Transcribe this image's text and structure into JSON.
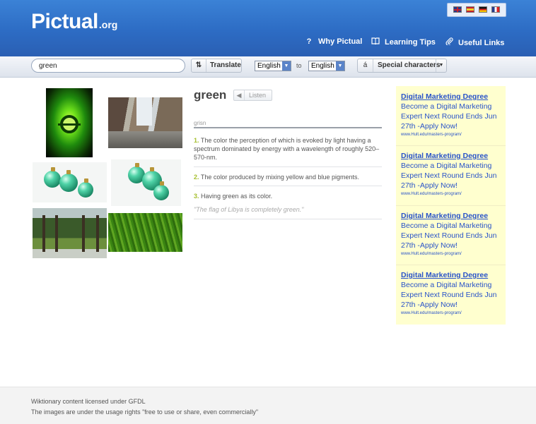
{
  "header": {
    "logo_main": "Pictual",
    "logo_tld": ".org",
    "languages": [
      "en",
      "es",
      "de",
      "fr"
    ],
    "nav": [
      {
        "label": "Why Pictual",
        "icon": "question-icon"
      },
      {
        "label": "Learning Tips",
        "icon": "book-icon"
      },
      {
        "label": "Useful Links",
        "icon": "paperclip-icon"
      }
    ]
  },
  "toolbar": {
    "search_value": "green",
    "translate_label": "Translate",
    "from_language": "English",
    "to_label": "to",
    "to_language": "English",
    "special_char": "á",
    "special_label": "Special characters"
  },
  "definition": {
    "word": "green",
    "listen_label": "Listen",
    "pronunciation": "grisn",
    "items": [
      {
        "num": "1.",
        "text": "The color the perception of which is evoked by light having a spectrum dominated by energy with a wavelength of roughly 520–570-nm."
      },
      {
        "num": "2.",
        "text": "The color produced by mixing yellow and blue pigments."
      },
      {
        "num": "3.",
        "text": "Having green as its color."
      }
    ],
    "example": "\"The flag of Libya is completely green.\""
  },
  "ads": [
    {
      "title": "Digital Marketing Degree",
      "body": "Become a Digital Marketing Expert Next Round Ends Jun 27th -Apply Now!",
      "url": "www.Hult.edu/masters-program/"
    },
    {
      "title": "Digital Marketing Degree",
      "body": "Become a Digital Marketing Expert Next Round Ends Jun 27th -Apply Now!",
      "url": "www.Hult.edu/masters-program/"
    },
    {
      "title": "Digital Marketing Degree",
      "body": "Become a Digital Marketing Expert Next Round Ends Jun 27th -Apply Now!",
      "url": "www.Hult.edu/masters-program/"
    },
    {
      "title": "Digital Marketing Degree",
      "body": "Become a Digital Marketing Expert Next Round Ends Jun 27th -Apply Now!",
      "url": "www.Hult.edu/masters-program/"
    }
  ],
  "footer": {
    "license": "Wiktionary content licensed under GFDL",
    "images": "The images are under the usage rights \"free to use or share, even commercially\""
  },
  "colors": {
    "header_blue": "#2d6cc4",
    "number_green": "#a5bf2e",
    "ad_link": "#2953c9",
    "ad_background": "#ffffcf"
  }
}
